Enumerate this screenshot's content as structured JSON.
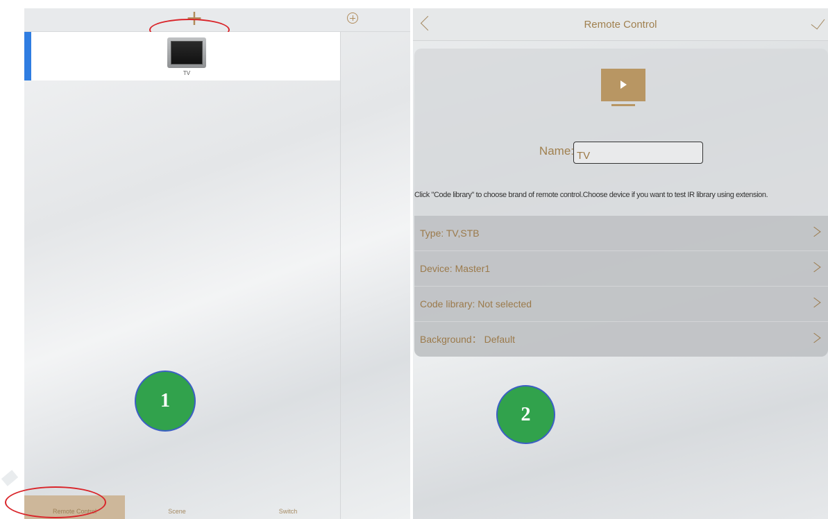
{
  "left": {
    "add_symbol": "+",
    "device": {
      "label": "TV"
    },
    "badge": "1",
    "tabs": [
      "Remote Control",
      "Scene",
      "Switch"
    ]
  },
  "right": {
    "title": "Remote Control",
    "name_label": "Name:",
    "name_value": "TV",
    "hint": "Click \"Code library\" to choose brand of remote control.Choose device if you want to test IR library using extension.",
    "rows": [
      {
        "label": "Type:  TV,STB"
      },
      {
        "label": "Device:  Master1"
      },
      {
        "label": "Code library:  Not selected"
      },
      {
        "label": "Background： Default"
      }
    ],
    "badge": "2"
  },
  "colors": {
    "accent_gold": "#a58a62",
    "selection_blue": "#2f7de1",
    "badge_green": "#31a24c",
    "annotation_red": "#d9252a"
  },
  "icons": [
    "add-icon",
    "circle-add-icon",
    "tv-icon",
    "back-arrow-icon",
    "checkmark-icon",
    "play-tv-icon",
    "chevron-right-icon"
  ]
}
